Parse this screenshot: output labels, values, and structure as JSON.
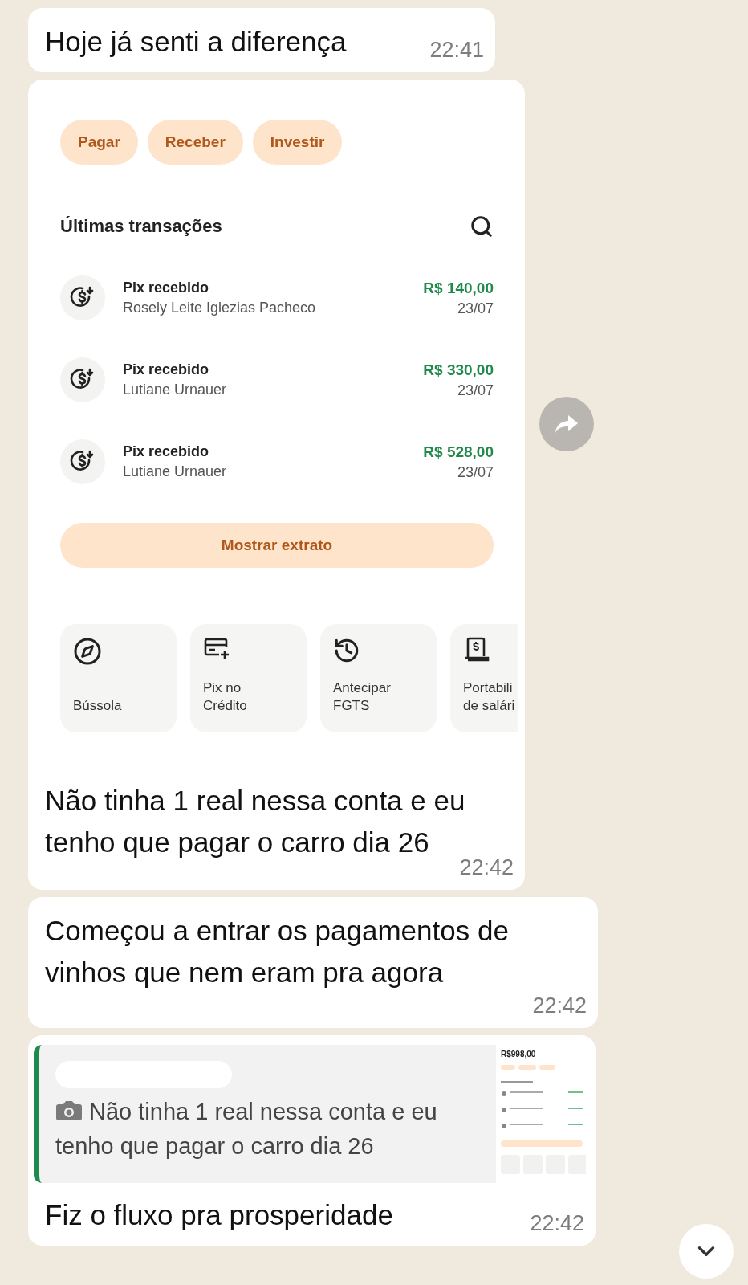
{
  "messages": [
    {
      "kind": "text",
      "text": "Hoje já senti a diferença",
      "time": "22:41"
    },
    {
      "kind": "image",
      "image": {
        "chips": [
          {
            "label": "Pagar"
          },
          {
            "label": "Receber"
          },
          {
            "label": "Investir"
          }
        ],
        "section_title": "Últimas transações",
        "transactions": [
          {
            "title": "Pix recebido",
            "name": "Rosely Leite Iglezias Pacheco",
            "amount": "R$ 140,00",
            "date": "23/07"
          },
          {
            "title": "Pix recebido",
            "name": "Lutiane Urnauer",
            "amount": "R$ 330,00",
            "date": "23/07"
          },
          {
            "title": "Pix recebido",
            "name": "Lutiane Urnauer",
            "amount": "R$ 528,00",
            "date": "23/07"
          }
        ],
        "button": "Mostrar extrato",
        "shortcuts": [
          {
            "kind": "compass",
            "label": "Bússola"
          },
          {
            "kind": "card",
            "label": "Pix no\nCrédito"
          },
          {
            "kind": "history",
            "label": "Antecipar\nFGTS"
          },
          {
            "kind": "receipt",
            "label": "Portabili\nde salári"
          }
        ]
      },
      "caption": "Não tinha 1 real nessa conta e eu tenho que pagar o carro dia 26",
      "time": "22:42"
    },
    {
      "kind": "text",
      "text": "Começou a entrar os pagamentos de vinhos que nem eram pra agora",
      "time": "22:42"
    },
    {
      "kind": "reply",
      "quote": "Não tinha 1 real nessa conta e eu tenho que pagar o carro dia 26",
      "thumbnail_amount": "R$998,00",
      "text": "Fiz o fluxo pra prosperidade",
      "time": "22:42"
    }
  ]
}
